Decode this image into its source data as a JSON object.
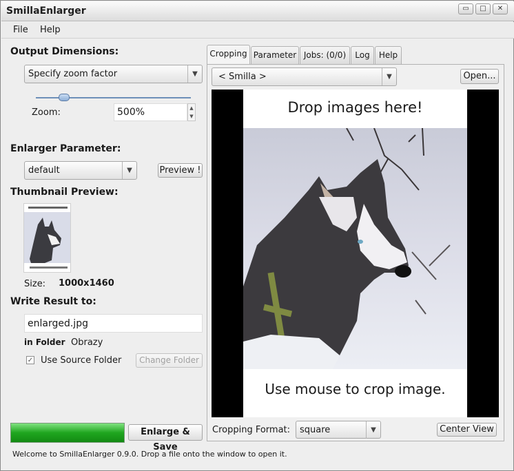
{
  "window": {
    "title": "SmillaEnlarger"
  },
  "titlebar_buttons": {
    "minimize": "▭",
    "maximize": "□",
    "close": "✕"
  },
  "menu": {
    "file": "File",
    "help": "Help"
  },
  "output": {
    "heading": "Output Dimensions:",
    "mode": "Specify zoom factor",
    "zoom_label": "Zoom:",
    "zoom_value": "500%",
    "slider_level": 0.18
  },
  "enlarger": {
    "heading": "Enlarger Parameter:",
    "preset": "default",
    "preview_button": "Preview !"
  },
  "thumbnail": {
    "heading": "Thumbnail Preview:",
    "size_label": "Size:",
    "size_value": "1000x1460"
  },
  "result": {
    "heading": "Write Result to:",
    "filename": "enlarged.jpg",
    "folder_label": "in Folder",
    "folder_value": "Obrazy",
    "use_source_label": "Use Source Folder",
    "use_source_checked": "✓",
    "change_folder": "Change Folder"
  },
  "actions": {
    "enlarge_save": "Enlarge & Save",
    "progress": 1.0
  },
  "tabs": [
    {
      "label": "Cropping"
    },
    {
      "label": "Parameter"
    },
    {
      "label": "Jobs: (0/0)"
    },
    {
      "label": "Log"
    },
    {
      "label": "Help"
    }
  ],
  "cropping": {
    "source": "< Smilla >",
    "open_button": "Open...",
    "drop_text": "Drop images here!",
    "crop_hint": "Use mouse to crop image.",
    "format_label": "Cropping Format:",
    "format_value": "square",
    "center_view": "Center View"
  },
  "status": "Welcome to SmillaEnlarger 0.9.0.  Drop a file onto the window to open it.",
  "colors": {
    "progress": "#1fa61f",
    "accent": "#2b6fb8"
  }
}
